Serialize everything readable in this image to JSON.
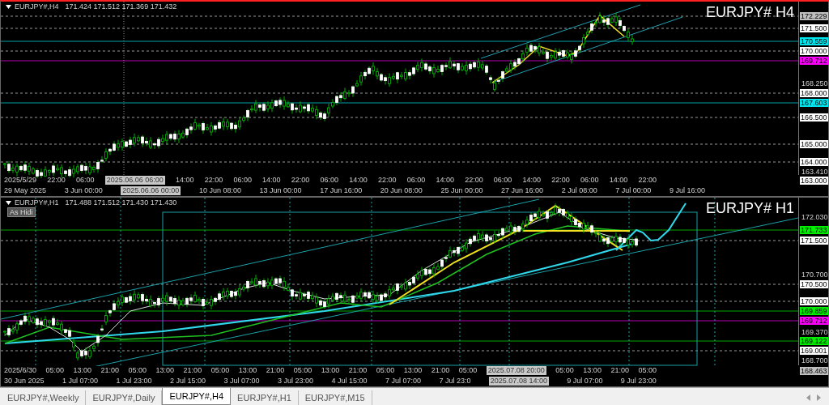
{
  "charts": [
    {
      "header": {
        "symbol": "EURJPY#,H4",
        "quote": "171.424 171.512 171.369 171.432"
      },
      "title": "EURJPY# H4",
      "price_axis": [
        {
          "text": "172.229",
          "kind": "level",
          "color": "#c0c0c0"
        },
        {
          "text": "171.500",
          "kind": "level",
          "color": "#ffffff"
        },
        {
          "text": "170.559",
          "kind": "level",
          "color": "#00e5ee"
        },
        {
          "text": "170.000",
          "kind": "level",
          "color": "#ffffff"
        },
        {
          "text": "169.712",
          "kind": "level",
          "color": "#ff00ff"
        },
        {
          "text": "168.250",
          "kind": "tick"
        },
        {
          "text": "168.000",
          "kind": "level",
          "color": "#ffffff"
        },
        {
          "text": "167.603",
          "kind": "level",
          "color": "#00e5ee"
        },
        {
          "text": "166.500",
          "kind": "level",
          "color": "#ffffff"
        },
        {
          "text": "165.000",
          "kind": "level",
          "color": "#ffffff"
        },
        {
          "text": "164.000",
          "kind": "level",
          "color": "#ffffff"
        },
        {
          "text": "163.410",
          "kind": "tick"
        },
        {
          "text": "163.000",
          "kind": "level",
          "color": "#ffffff"
        }
      ],
      "time_axis": {
        "upper": [
          {
            "text": "2025/5/29",
            "kind": "tick"
          },
          {
            "text": "22:00",
            "kind": "tick"
          },
          {
            "text": "06:00",
            "kind": "tick"
          },
          {
            "text": "2025.06.06 06:00",
            "kind": "cursor"
          },
          {
            "text": "14:00",
            "kind": "tick"
          },
          {
            "text": "22:00",
            "kind": "tick"
          },
          {
            "text": "06:00",
            "kind": "tick"
          },
          {
            "text": "14:00",
            "kind": "tick"
          },
          {
            "text": "22:00",
            "kind": "tick"
          },
          {
            "text": "06:00",
            "kind": "tick"
          },
          {
            "text": "14:00",
            "kind": "tick"
          },
          {
            "text": "22:00",
            "kind": "tick"
          },
          {
            "text": "06:00",
            "kind": "tick"
          },
          {
            "text": "14:00",
            "kind": "tick"
          },
          {
            "text": "22:00",
            "kind": "tick"
          },
          {
            "text": "06:00",
            "kind": "tick"
          },
          {
            "text": "14:00",
            "kind": "tick"
          },
          {
            "text": "22:00",
            "kind": "tick"
          },
          {
            "text": "06:00",
            "kind": "tick"
          },
          {
            "text": "14:00",
            "kind": "tick"
          },
          {
            "text": "22:00",
            "kind": "tick"
          }
        ],
        "lower": [
          {
            "text": "29 May 2025",
            "kind": "tick"
          },
          {
            "text": "3 Jun 00:00",
            "kind": "tick"
          },
          {
            "text": "2025.06.06 00:00",
            "kind": "cursor"
          },
          {
            "text": "10 Jun 08:00",
            "kind": "tick"
          },
          {
            "text": "13 Jun 00:00",
            "kind": "tick"
          },
          {
            "text": "17 Jun 16:00",
            "kind": "tick"
          },
          {
            "text": "20 Jun 08:00",
            "kind": "tick"
          },
          {
            "text": "25 Jun 00:00",
            "kind": "tick"
          },
          {
            "text": "27 Jun 16:00",
            "kind": "tick"
          },
          {
            "text": "2 Jul 08:00",
            "kind": "tick"
          },
          {
            "text": "7 Jul 00:00",
            "kind": "tick"
          },
          {
            "text": "9 Jul 16:00",
            "kind": "tick"
          }
        ]
      }
    },
    {
      "header": {
        "symbol": "EURJPY#,H1",
        "quote": "171.488 171.512 171.430 171.430"
      },
      "button": "As Hidi",
      "title": "EURJPY# H1",
      "price_axis": [
        {
          "text": "172.030",
          "kind": "tick"
        },
        {
          "text": "171.733",
          "kind": "level",
          "color": "#00ee00"
        },
        {
          "text": "171.500",
          "kind": "level",
          "color": "#ffffff"
        },
        {
          "text": "170.700",
          "kind": "tick"
        },
        {
          "text": "170.500",
          "kind": "level",
          "color": "#ffffff"
        },
        {
          "text": "170.000",
          "kind": "level",
          "color": "#ffffff"
        },
        {
          "text": "169.859",
          "kind": "level",
          "color": "#00ee00"
        },
        {
          "text": "169.712",
          "kind": "level",
          "color": "#ff00ff"
        },
        {
          "text": "169.370",
          "kind": "tick"
        },
        {
          "text": "169.122",
          "kind": "level",
          "color": "#00ee00"
        },
        {
          "text": "169.001",
          "kind": "level",
          "color": "#ffffff"
        },
        {
          "text": "168.700",
          "kind": "tick"
        },
        {
          "text": "168.463",
          "kind": "level",
          "color": "#c0c0c0"
        }
      ],
      "time_axis": {
        "upper": [
          {
            "text": "2025/6/30",
            "kind": "tick"
          },
          {
            "text": "05:00",
            "kind": "tick"
          },
          {
            "text": "13:00",
            "kind": "tick"
          },
          {
            "text": "21:00",
            "kind": "tick"
          },
          {
            "text": "05:00",
            "kind": "tick"
          },
          {
            "text": "13:00",
            "kind": "tick"
          },
          {
            "text": "21:00",
            "kind": "tick"
          },
          {
            "text": "05:00",
            "kind": "tick"
          },
          {
            "text": "13:00",
            "kind": "tick"
          },
          {
            "text": "21:00",
            "kind": "tick"
          },
          {
            "text": "05:00",
            "kind": "tick"
          },
          {
            "text": "13:00",
            "kind": "tick"
          },
          {
            "text": "21:00",
            "kind": "tick"
          },
          {
            "text": "05:00",
            "kind": "tick"
          },
          {
            "text": "13:00",
            "kind": "tick"
          },
          {
            "text": "21:00",
            "kind": "tick"
          },
          {
            "text": "05:00",
            "kind": "tick"
          },
          {
            "text": "2025.07.08 20:00",
            "kind": "cursor"
          },
          {
            "text": "05:00",
            "kind": "tick"
          },
          {
            "text": "13:00",
            "kind": "tick"
          },
          {
            "text": "21:00",
            "kind": "tick"
          },
          {
            "text": "05:00",
            "kind": "tick"
          }
        ],
        "lower": [
          {
            "text": "30 Jun 2025",
            "kind": "tick"
          },
          {
            "text": "1 Jul 07:00",
            "kind": "tick"
          },
          {
            "text": "1 Jul 23:00",
            "kind": "tick"
          },
          {
            "text": "2 Jul 15:00",
            "kind": "tick"
          },
          {
            "text": "3 Jul 07:00",
            "kind": "tick"
          },
          {
            "text": "3 Jul 23:00",
            "kind": "tick"
          },
          {
            "text": "4 Jul 15:00",
            "kind": "tick"
          },
          {
            "text": "7 Jul 07:00",
            "kind": "tick"
          },
          {
            "text": "7 Jul 23:0",
            "kind": "tick"
          },
          {
            "text": "2025.07.08 14:00",
            "kind": "cursor"
          },
          {
            "text": "9 Jul 07:00",
            "kind": "tick"
          },
          {
            "text": "9 Jul 23:00",
            "kind": "tick"
          }
        ]
      }
    }
  ],
  "tabs": [
    {
      "label": "EURJPY#,Weekly",
      "selected": false
    },
    {
      "label": "EURJPY#,Daily",
      "selected": false
    },
    {
      "label": "EURJPY#,H4",
      "selected": true
    },
    {
      "label": "EURJPY#,H1",
      "selected": false
    },
    {
      "label": "EURJPY#,M15",
      "selected": false
    }
  ]
}
